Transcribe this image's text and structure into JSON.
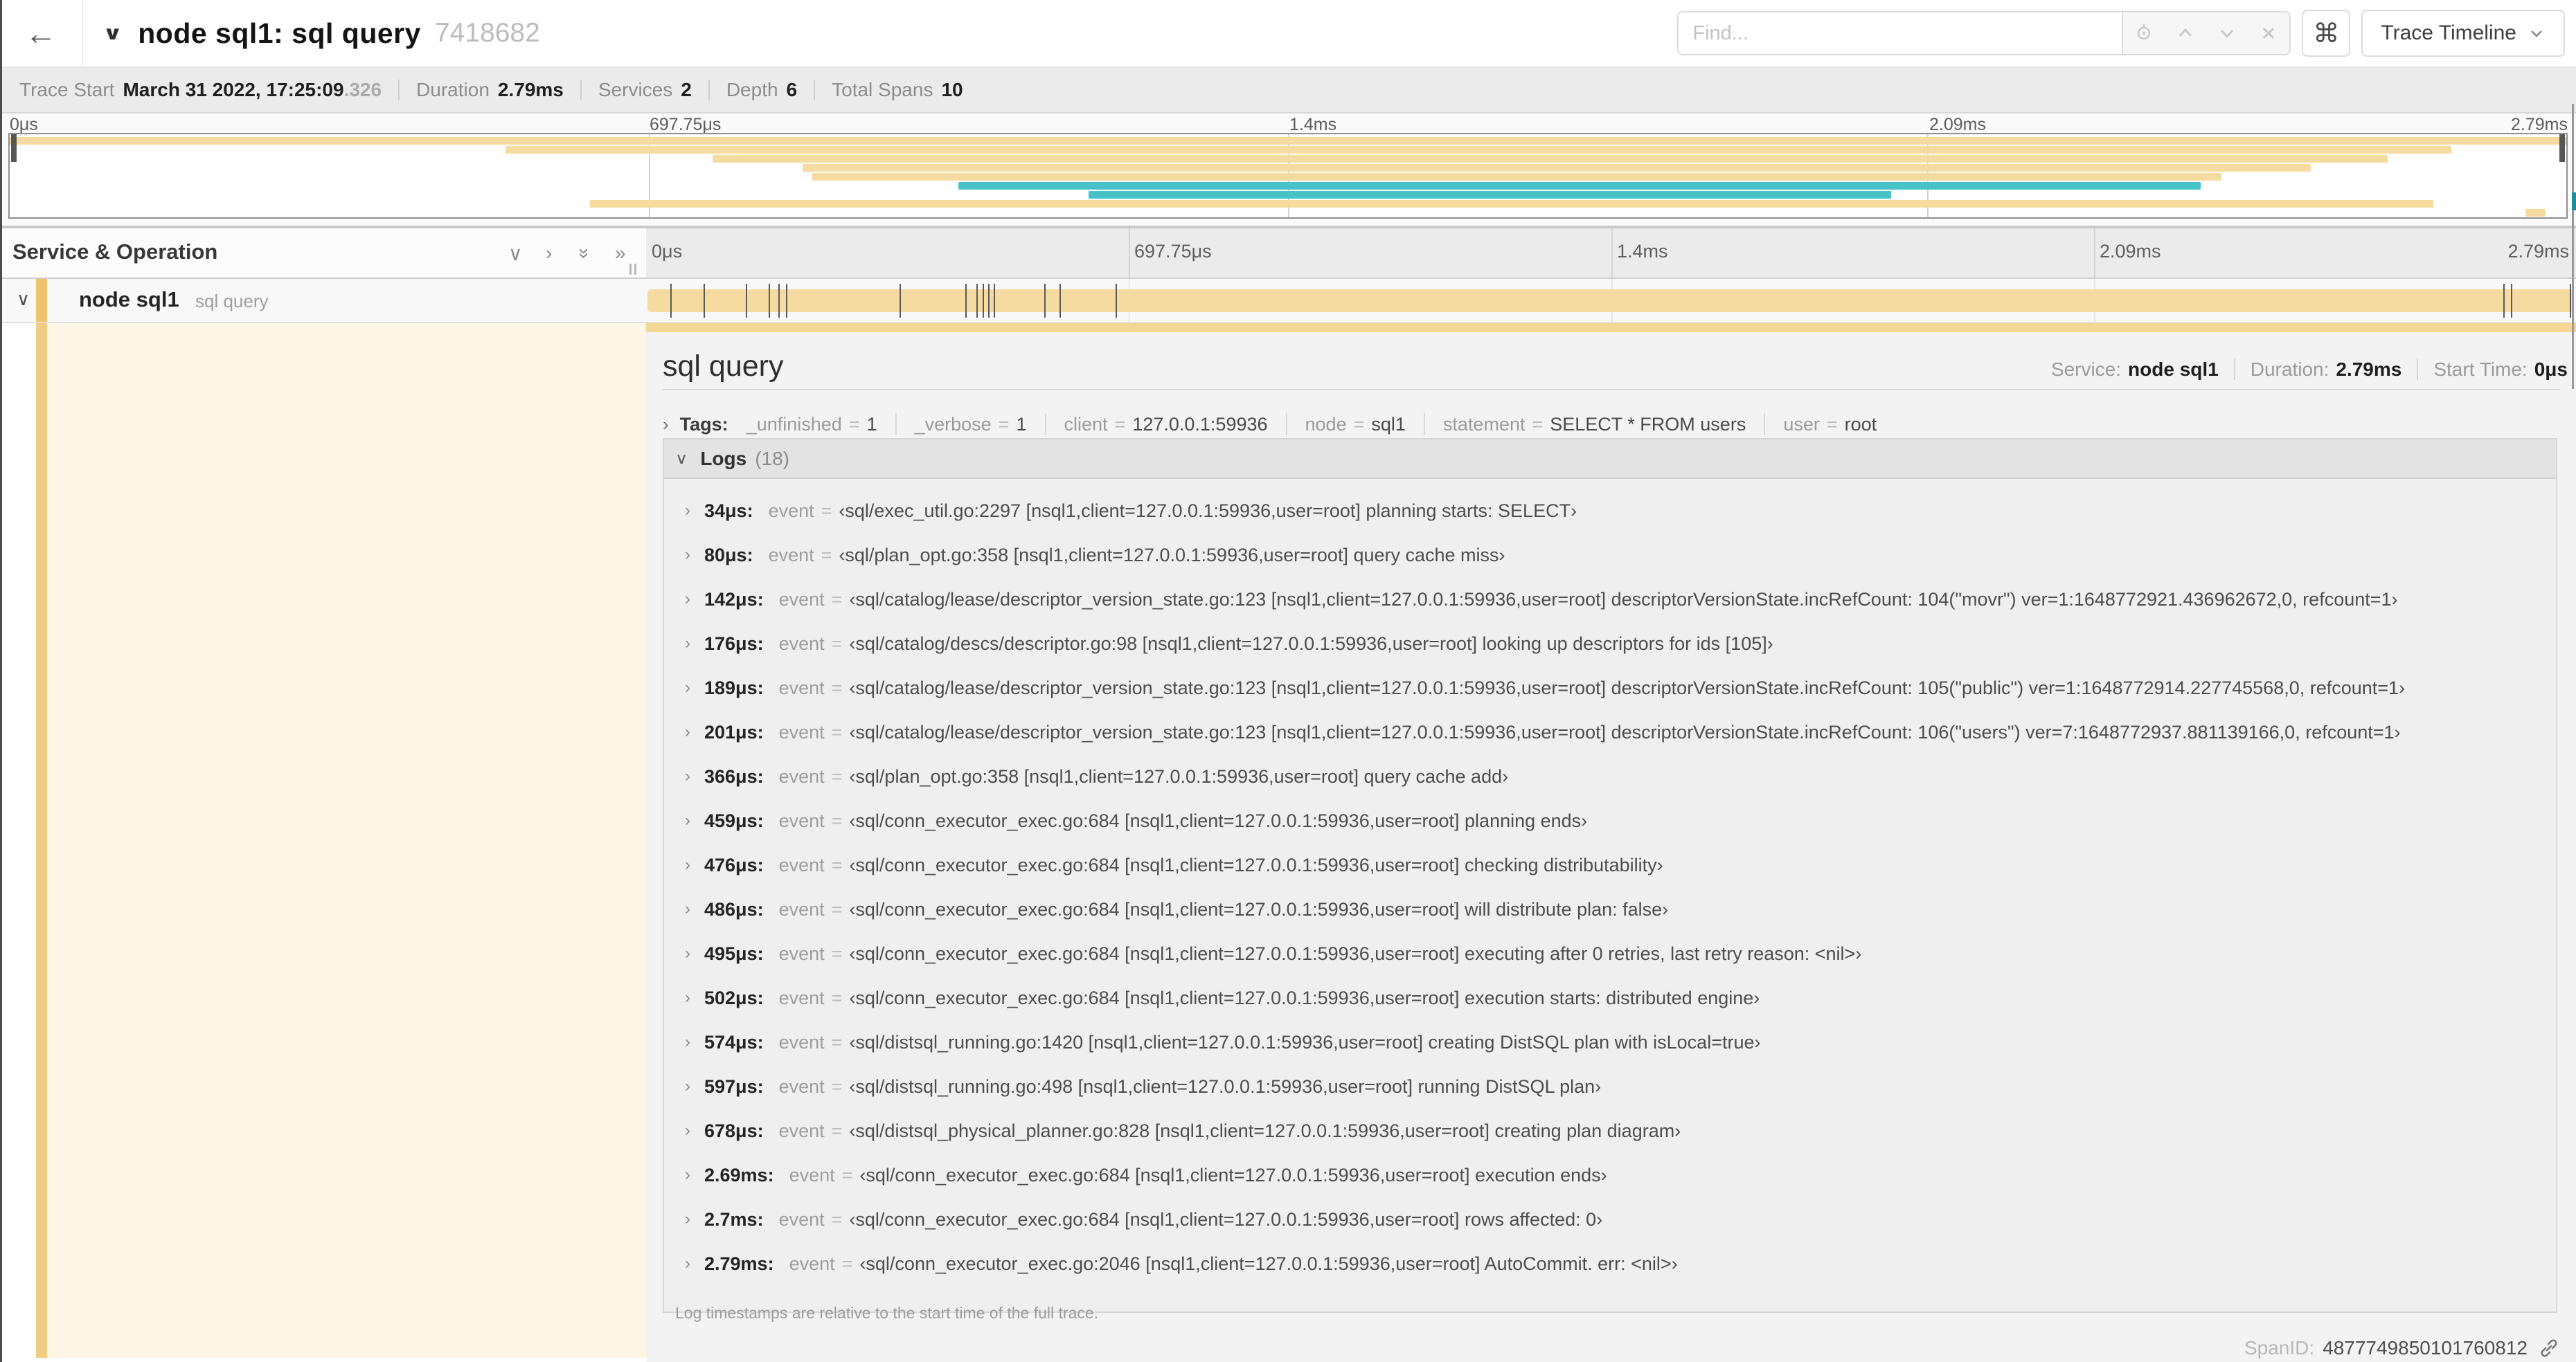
{
  "header": {
    "back_glyph": "←",
    "title_chevron": "∨",
    "title": "node sql1: sql query",
    "trace_id": "7418682",
    "find_placeholder": "Find...",
    "shortcut_glyph": "⌘",
    "view_dropdown_label": "Trace Timeline"
  },
  "trace_stats": {
    "trace_start_label": "Trace Start",
    "trace_start_value": "March 31 2022, 17:25:09",
    "trace_start_fraction": ".326",
    "duration_label": "Duration",
    "duration_value": "2.79ms",
    "services_label": "Services",
    "services_value": "2",
    "depth_label": "Depth",
    "depth_value": "6",
    "total_spans_label": "Total Spans",
    "total_spans_value": "10"
  },
  "minimap": {
    "tick_labels": [
      "0μs",
      "697.75μs",
      "1.4ms",
      "2.09ms",
      "2.79ms"
    ],
    "spans": [
      {
        "start": 0.0,
        "end": 1.0,
        "color": "tan"
      },
      {
        "start": 0.194,
        "end": 0.955,
        "color": "tan"
      },
      {
        "start": 0.275,
        "end": 0.93,
        "color": "tan"
      },
      {
        "start": 0.31,
        "end": 0.9,
        "color": "tan"
      },
      {
        "start": 0.314,
        "end": 0.865,
        "color": "tan"
      },
      {
        "start": 0.371,
        "end": 0.857,
        "color": "teal"
      },
      {
        "start": 0.422,
        "end": 0.736,
        "color": "teal"
      },
      {
        "start": 0.227,
        "end": 0.948,
        "color": "tan"
      },
      {
        "start": 0.984,
        "end": 0.992,
        "color": "tan"
      }
    ]
  },
  "grid": {
    "left_header": "Service & Operation",
    "ruler_ticks": [
      "0μs",
      "697.75μs",
      "1.4ms",
      "2.09ms",
      "2.79ms"
    ]
  },
  "span_row": {
    "chevron": "∨",
    "service": "node sql1",
    "operation": "sql query",
    "log_marker_fractions": [
      0.012,
      0.029,
      0.051,
      0.063,
      0.068,
      0.072,
      0.131,
      0.165,
      0.171,
      0.174,
      0.177,
      0.18,
      0.206,
      0.214,
      0.243,
      0.964,
      0.968,
      0.9985
    ]
  },
  "detail": {
    "operation": "sql query",
    "service_label": "Service:",
    "service_value": "node sql1",
    "duration_label": "Duration:",
    "duration_value": "2.79ms",
    "start_time_label": "Start Time:",
    "start_time_value": "0μs",
    "tags_label": "Tags:",
    "tags": [
      {
        "key": "_unfinished",
        "value": "1"
      },
      {
        "key": "_verbose",
        "value": "1"
      },
      {
        "key": "client",
        "value": "127.0.0.1:59936"
      },
      {
        "key": "node",
        "value": "sql1"
      },
      {
        "key": "statement",
        "value": "SELECT * FROM users"
      },
      {
        "key": "user",
        "value": "root"
      }
    ],
    "logs_label": "Logs",
    "logs_count": "(18)",
    "logs": [
      {
        "time": "34μs:",
        "key": "event",
        "value": "‹sql/exec_util.go:2297 [nsql1,client=127.0.0.1:59936,user=root] planning starts: SELECT›"
      },
      {
        "time": "80μs:",
        "key": "event",
        "value": "‹sql/plan_opt.go:358 [nsql1,client=127.0.0.1:59936,user=root] query cache miss›"
      },
      {
        "time": "142μs:",
        "key": "event",
        "value": "‹sql/catalog/lease/descriptor_version_state.go:123 [nsql1,client=127.0.0.1:59936,user=root] descriptorVersionState.incRefCount: 104(\"movr\") ver=1:1648772921.436962672,0, refcount=1›"
      },
      {
        "time": "176μs:",
        "key": "event",
        "value": "‹sql/catalog/descs/descriptor.go:98 [nsql1,client=127.0.0.1:59936,user=root] looking up descriptors for ids [105]›"
      },
      {
        "time": "189μs:",
        "key": "event",
        "value": "‹sql/catalog/lease/descriptor_version_state.go:123 [nsql1,client=127.0.0.1:59936,user=root] descriptorVersionState.incRefCount: 105(\"public\") ver=1:1648772914.227745568,0, refcount=1›"
      },
      {
        "time": "201μs:",
        "key": "event",
        "value": "‹sql/catalog/lease/descriptor_version_state.go:123 [nsql1,client=127.0.0.1:59936,user=root] descriptorVersionState.incRefCount: 106(\"users\") ver=7:1648772937.881139166,0, refcount=1›"
      },
      {
        "time": "366μs:",
        "key": "event",
        "value": "‹sql/plan_opt.go:358 [nsql1,client=127.0.0.1:59936,user=root] query cache add›"
      },
      {
        "time": "459μs:",
        "key": "event",
        "value": "‹sql/conn_executor_exec.go:684 [nsql1,client=127.0.0.1:59936,user=root] planning ends›"
      },
      {
        "time": "476μs:",
        "key": "event",
        "value": "‹sql/conn_executor_exec.go:684 [nsql1,client=127.0.0.1:59936,user=root] checking distributability›"
      },
      {
        "time": "486μs:",
        "key": "event",
        "value": "‹sql/conn_executor_exec.go:684 [nsql1,client=127.0.0.1:59936,user=root] will distribute plan: false›"
      },
      {
        "time": "495μs:",
        "key": "event",
        "value": "‹sql/conn_executor_exec.go:684 [nsql1,client=127.0.0.1:59936,user=root] executing after 0 retries, last retry reason: <nil>›"
      },
      {
        "time": "502μs:",
        "key": "event",
        "value": "‹sql/conn_executor_exec.go:684 [nsql1,client=127.0.0.1:59936,user=root] execution starts: distributed engine›"
      },
      {
        "time": "574μs:",
        "key": "event",
        "value": "‹sql/distsql_running.go:1420 [nsql1,client=127.0.0.1:59936,user=root] creating DistSQL plan with isLocal=true›"
      },
      {
        "time": "597μs:",
        "key": "event",
        "value": "‹sql/distsql_running.go:498 [nsql1,client=127.0.0.1:59936,user=root] running DistSQL plan›"
      },
      {
        "time": "678μs:",
        "key": "event",
        "value": "‹sql/distsql_physical_planner.go:828 [nsql1,client=127.0.0.1:59936,user=root] creating plan diagram›"
      },
      {
        "time": "2.69ms:",
        "key": "event",
        "value": "‹sql/conn_executor_exec.go:684 [nsql1,client=127.0.0.1:59936,user=root] execution ends›"
      },
      {
        "time": "2.7ms:",
        "key": "event",
        "value": "‹sql/conn_executor_exec.go:684 [nsql1,client=127.0.0.1:59936,user=root] rows affected: 0›"
      },
      {
        "time": "2.79ms:",
        "key": "event",
        "value": "‹sql/conn_executor_exec.go:2046 [nsql1,client=127.0.0.1:59936,user=root] AutoCommit. err: <nil>›"
      }
    ],
    "footer_note": "Log timestamps are relative to the start time of the full trace.",
    "span_id_label": "SpanID:",
    "span_id": "4877749850101760812"
  },
  "colors": {
    "tan_bar": "#f6dba1",
    "tan_accent": "#eec36e",
    "tan_topbar": "#f5d795",
    "cream_fill": "#fdf6e6",
    "cream_strip": "#f0cd85",
    "teal_bar": "#49c2c7"
  }
}
